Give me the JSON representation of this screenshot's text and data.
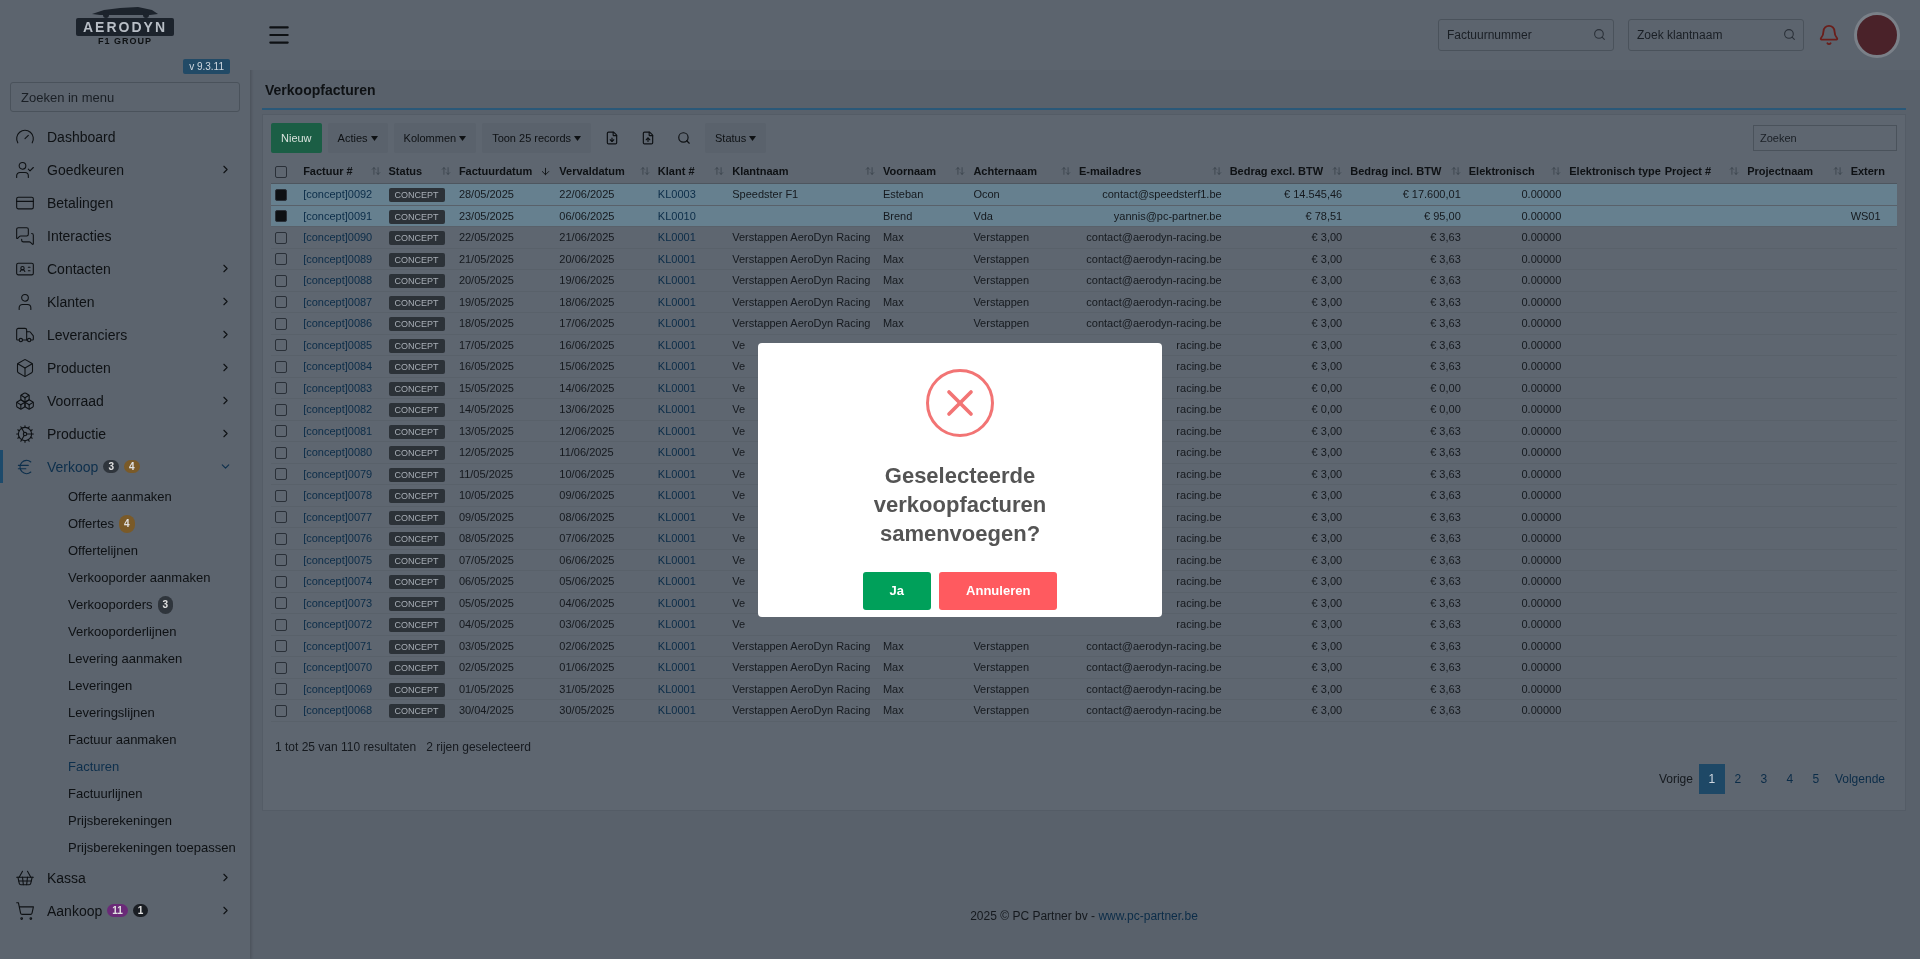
{
  "sidebar": {
    "logo": {
      "name": "AERODYN",
      "sub": "F1 GROUP"
    },
    "version": "v 9.3.11",
    "search_placeholder": "Zoeken in menu",
    "items": [
      {
        "label": "Dashboard",
        "has_children": false,
        "selected": false
      },
      {
        "label": "Goedkeuren",
        "has_children": true,
        "selected": false
      },
      {
        "label": "Betalingen",
        "has_children": false,
        "selected": false
      },
      {
        "label": "Interacties",
        "has_children": false,
        "selected": false
      },
      {
        "label": "Contacten",
        "has_children": true,
        "selected": false
      },
      {
        "label": "Klanten",
        "has_children": true,
        "selected": false
      },
      {
        "label": "Leveranciers",
        "has_children": true,
        "selected": false
      },
      {
        "label": "Producten",
        "has_children": true,
        "selected": false
      },
      {
        "label": "Voorraad",
        "has_children": true,
        "selected": false
      },
      {
        "label": "Productie",
        "has_children": true,
        "selected": false
      },
      {
        "label": "Verkoop",
        "has_children": true,
        "selected": true,
        "expanded": true,
        "badges": [
          {
            "text": "3",
            "color": "#2f353c"
          },
          {
            "text": "4",
            "color": "#7a5a28"
          }
        ],
        "children": [
          {
            "label": "Offerte aanmaken",
            "selected": false
          },
          {
            "label": "Offertes",
            "selected": false,
            "badges": [
              {
                "text": "4",
                "color": "#7a5a28"
              }
            ]
          },
          {
            "label": "Offertelijnen",
            "selected": false
          },
          {
            "label": "Verkooporder aanmaken",
            "selected": false
          },
          {
            "label": "Verkooporders",
            "selected": false,
            "badges": [
              {
                "text": "3",
                "color": "#2f353c"
              }
            ]
          },
          {
            "label": "Verkooporderlijnen",
            "selected": false
          },
          {
            "label": "Levering aanmaken",
            "selected": false
          },
          {
            "label": "Leveringen",
            "selected": false
          },
          {
            "label": "Leveringslijnen",
            "selected": false
          },
          {
            "label": "Factuur aanmaken",
            "selected": false
          },
          {
            "label": "Facturen",
            "selected": true
          },
          {
            "label": "Factuurlijnen",
            "selected": false
          },
          {
            "label": "Prijsberekeningen",
            "selected": false
          },
          {
            "label": "Prijsberekeningen toepassen",
            "selected": false
          }
        ]
      },
      {
        "label": "Kassa",
        "has_children": true,
        "selected": false
      },
      {
        "label": "Aankoop",
        "has_children": true,
        "selected": false,
        "badges": [
          {
            "text": "11",
            "color": "#6a2a78"
          },
          {
            "text": "1",
            "color": "#1a1e24"
          }
        ]
      }
    ]
  },
  "header": {
    "search_fields": [
      {
        "placeholder": "Factuurnummer"
      },
      {
        "placeholder": "Zoek klantnaam"
      }
    ]
  },
  "page": {
    "title": "Verkoopfacturen"
  },
  "toolbar": {
    "buttons": [
      {
        "kind": "primary",
        "label": "Nieuw"
      },
      {
        "kind": "dropdown",
        "label": "Acties"
      },
      {
        "kind": "dropdown",
        "label": "Kolommen"
      },
      {
        "kind": "dropdown",
        "label": "Toon 25 records"
      },
      {
        "kind": "icon"
      },
      {
        "kind": "icon"
      },
      {
        "kind": "icon"
      },
      {
        "kind": "dropdown",
        "label": "Status"
      }
    ],
    "search_placeholder": "Zoeken"
  },
  "table": {
    "select_all_checked": false,
    "columns": [
      {
        "label": "Factuur #",
        "sortable": true,
        "sorted": false
      },
      {
        "label": "Status",
        "sortable": true,
        "sorted": false
      },
      {
        "label": "Factuurdatum",
        "sortable": true,
        "sorted": true
      },
      {
        "label": "Vervaldatum",
        "sortable": true,
        "sorted": false
      },
      {
        "label": "Klant #",
        "sortable": true,
        "sorted": false
      },
      {
        "label": "Klantnaam",
        "sortable": true,
        "sorted": false
      },
      {
        "label": "Voornaam",
        "sortable": true,
        "sorted": false
      },
      {
        "label": "Achternaam",
        "sortable": true,
        "sorted": false
      },
      {
        "label": "E-mailadres",
        "sortable": true,
        "sorted": false
      },
      {
        "label": "Bedrag excl. BTW",
        "sortable": true,
        "sorted": false
      },
      {
        "label": "Bedrag incl. BTW",
        "sortable": true,
        "sorted": false
      },
      {
        "label": "Elektronisch",
        "sortable": true,
        "sorted": false
      },
      {
        "label": "Elektronisch type",
        "sortable": false
      },
      {
        "label": "Project #",
        "sortable": true,
        "sorted": false
      },
      {
        "label": "Projectnaam",
        "sortable": true,
        "sorted": false
      },
      {
        "label": "Extern",
        "sortable": false
      }
    ],
    "rows": [
      {
        "selected": true,
        "factuur": "[concept]0092",
        "status": "CONCEPT",
        "datum": "28/05/2025",
        "verval": "22/06/2025",
        "klant": "KL0003",
        "klantnaam": "Speedster F1",
        "voornaam": "Esteban",
        "achternaam": "Ocon",
        "email": "contact@speedsterf1.be",
        "excl": "€ 14.545,46",
        "incl": "€ 17.600,01",
        "elek": "0.00000"
      },
      {
        "selected": true,
        "factuur": "[concept]0091",
        "status": "CONCEPT",
        "datum": "23/05/2025",
        "verval": "06/06/2025",
        "klant": "KL0010",
        "voornaam": "Brend",
        "achternaam": "Vda",
        "email": "yannis@pc-partner.be",
        "excl": "€ 78,51",
        "incl": "€ 95,00",
        "elek": "0.00000",
        "extern": "WS01"
      },
      {
        "selected": false,
        "factuur": "[concept]0090",
        "status": "CONCEPT",
        "datum": "22/05/2025",
        "verval": "21/06/2025",
        "klant": "KL0001",
        "klantnaam": "Verstappen AeroDyn Racing",
        "voornaam": "Max",
        "achternaam": "Verstappen",
        "email": "contact@aerodyn-racing.be",
        "excl": "€ 3,00",
        "incl": "€ 3,63",
        "elek": "0.00000"
      },
      {
        "selected": false,
        "factuur": "[concept]0089",
        "status": "CONCEPT",
        "datum": "21/05/2025",
        "verval": "20/06/2025",
        "klant": "KL0001",
        "klantnaam": "Verstappen AeroDyn Racing",
        "voornaam": "Max",
        "achternaam": "Verstappen",
        "email": "contact@aerodyn-racing.be",
        "excl": "€ 3,00",
        "incl": "€ 3,63",
        "elek": "0.00000"
      },
      {
        "selected": false,
        "factuur": "[concept]0088",
        "status": "CONCEPT",
        "datum": "20/05/2025",
        "verval": "19/06/2025",
        "klant": "KL0001",
        "klantnaam": "Verstappen AeroDyn Racing",
        "voornaam": "Max",
        "achternaam": "Verstappen",
        "email": "contact@aerodyn-racing.be",
        "excl": "€ 3,00",
        "incl": "€ 3,63",
        "elek": "0.00000"
      },
      {
        "selected": false,
        "factuur": "[concept]0087",
        "status": "CONCEPT",
        "datum": "19/05/2025",
        "verval": "18/06/2025",
        "klant": "KL0001",
        "klantnaam": "Verstappen AeroDyn Racing",
        "voornaam": "Max",
        "achternaam": "Verstappen",
        "email": "contact@aerodyn-racing.be",
        "excl": "€ 3,00",
        "incl": "€ 3,63",
        "elek": "0.00000"
      },
      {
        "selected": false,
        "factuur": "[concept]0086",
        "status": "CONCEPT",
        "datum": "18/05/2025",
        "verval": "17/06/2025",
        "klant": "KL0001",
        "klantnaam": "Verstappen AeroDyn Racing",
        "voornaam": "Max",
        "achternaam": "Verstappen",
        "email": "contact@aerodyn-racing.be",
        "excl": "€ 3,00",
        "incl": "€ 3,63",
        "elek": "0.00000"
      },
      {
        "selected": false,
        "factuur": "[concept]0085",
        "status": "CONCEPT",
        "datum": "17/05/2025",
        "verval": "16/06/2025",
        "klant": "KL0001",
        "klantnaam": "Ve",
        "email": "racing.be",
        "excl": "€ 3,00",
        "incl": "€ 3,63",
        "elek": "0.00000"
      },
      {
        "selected": false,
        "factuur": "[concept]0084",
        "status": "CONCEPT",
        "datum": "16/05/2025",
        "verval": "15/06/2025",
        "klant": "KL0001",
        "klantnaam": "Ve",
        "email": "racing.be",
        "excl": "€ 3,00",
        "incl": "€ 3,63",
        "elek": "0.00000"
      },
      {
        "selected": false,
        "factuur": "[concept]0083",
        "status": "CONCEPT",
        "datum": "15/05/2025",
        "verval": "14/06/2025",
        "klant": "KL0001",
        "klantnaam": "Ve",
        "email": "racing.be",
        "excl": "€ 0,00",
        "incl": "€ 0,00",
        "elek": "0.00000"
      },
      {
        "selected": false,
        "factuur": "[concept]0082",
        "status": "CONCEPT",
        "datum": "14/05/2025",
        "verval": "13/06/2025",
        "klant": "KL0001",
        "klantnaam": "Ve",
        "email": "racing.be",
        "excl": "€ 0,00",
        "incl": "€ 0,00",
        "elek": "0.00000"
      },
      {
        "selected": false,
        "factuur": "[concept]0081",
        "status": "CONCEPT",
        "datum": "13/05/2025",
        "verval": "12/06/2025",
        "klant": "KL0001",
        "klantnaam": "Ve",
        "email": "racing.be",
        "excl": "€ 3,00",
        "incl": "€ 3,63",
        "elek": "0.00000"
      },
      {
        "selected": false,
        "factuur": "[concept]0080",
        "status": "CONCEPT",
        "datum": "12/05/2025",
        "verval": "11/06/2025",
        "klant": "KL0001",
        "klantnaam": "Ve",
        "email": "racing.be",
        "excl": "€ 3,00",
        "incl": "€ 3,63",
        "elek": "0.00000"
      },
      {
        "selected": false,
        "factuur": "[concept]0079",
        "status": "CONCEPT",
        "datum": "11/05/2025",
        "verval": "10/06/2025",
        "klant": "KL0001",
        "klantnaam": "Ve",
        "email": "racing.be",
        "excl": "€ 3,00",
        "incl": "€ 3,63",
        "elek": "0.00000"
      },
      {
        "selected": false,
        "factuur": "[concept]0078",
        "status": "CONCEPT",
        "datum": "10/05/2025",
        "verval": "09/06/2025",
        "klant": "KL0001",
        "klantnaam": "Ve",
        "email": "racing.be",
        "excl": "€ 3,00",
        "incl": "€ 3,63",
        "elek": "0.00000"
      },
      {
        "selected": false,
        "factuur": "[concept]0077",
        "status": "CONCEPT",
        "datum": "09/05/2025",
        "verval": "08/06/2025",
        "klant": "KL0001",
        "klantnaam": "Ve",
        "email": "racing.be",
        "excl": "€ 3,00",
        "incl": "€ 3,63",
        "elek": "0.00000"
      },
      {
        "selected": false,
        "factuur": "[concept]0076",
        "status": "CONCEPT",
        "datum": "08/05/2025",
        "verval": "07/06/2025",
        "klant": "KL0001",
        "klantnaam": "Ve",
        "email": "racing.be",
        "excl": "€ 3,00",
        "incl": "€ 3,63",
        "elek": "0.00000"
      },
      {
        "selected": false,
        "factuur": "[concept]0075",
        "status": "CONCEPT",
        "datum": "07/05/2025",
        "verval": "06/06/2025",
        "klant": "KL0001",
        "klantnaam": "Ve",
        "email": "racing.be",
        "excl": "€ 3,00",
        "incl": "€ 3,63",
        "elek": "0.00000"
      },
      {
        "selected": false,
        "factuur": "[concept]0074",
        "status": "CONCEPT",
        "datum": "06/05/2025",
        "verval": "05/06/2025",
        "klant": "KL0001",
        "klantnaam": "Ve",
        "email": "racing.be",
        "excl": "€ 3,00",
        "incl": "€ 3,63",
        "elek": "0.00000"
      },
      {
        "selected": false,
        "factuur": "[concept]0073",
        "status": "CONCEPT",
        "datum": "05/05/2025",
        "verval": "04/06/2025",
        "klant": "KL0001",
        "klantnaam": "Ve",
        "email": "racing.be",
        "excl": "€ 3,00",
        "incl": "€ 3,63",
        "elek": "0.00000"
      },
      {
        "selected": false,
        "factuur": "[concept]0072",
        "status": "CONCEPT",
        "datum": "04/05/2025",
        "verval": "03/06/2025",
        "klant": "KL0001",
        "klantnaam": "Ve",
        "email": "racing.be",
        "excl": "€ 3,00",
        "incl": "€ 3,63",
        "elek": "0.00000"
      },
      {
        "selected": false,
        "factuur": "[concept]0071",
        "status": "CONCEPT",
        "datum": "03/05/2025",
        "verval": "02/06/2025",
        "klant": "KL0001",
        "klantnaam": "Verstappen AeroDyn Racing",
        "voornaam": "Max",
        "achternaam": "Verstappen",
        "email": "contact@aerodyn-racing.be",
        "excl": "€ 3,00",
        "incl": "€ 3,63",
        "elek": "0.00000"
      },
      {
        "selected": false,
        "factuur": "[concept]0070",
        "status": "CONCEPT",
        "datum": "02/05/2025",
        "verval": "01/06/2025",
        "klant": "KL0001",
        "klantnaam": "Verstappen AeroDyn Racing",
        "voornaam": "Max",
        "achternaam": "Verstappen",
        "email": "contact@aerodyn-racing.be",
        "excl": "€ 3,00",
        "incl": "€ 3,63",
        "elek": "0.00000"
      },
      {
        "selected": false,
        "factuur": "[concept]0069",
        "status": "CONCEPT",
        "datum": "01/05/2025",
        "verval": "31/05/2025",
        "klant": "KL0001",
        "klantnaam": "Verstappen AeroDyn Racing",
        "voornaam": "Max",
        "achternaam": "Verstappen",
        "email": "contact@aerodyn-racing.be",
        "excl": "€ 3,00",
        "incl": "€ 3,63",
        "elek": "0.00000"
      },
      {
        "selected": false,
        "factuur": "[concept]0068",
        "status": "CONCEPT",
        "datum": "30/04/2025",
        "verval": "30/05/2025",
        "klant": "KL0001",
        "klantnaam": "Verstappen AeroDyn Racing",
        "voornaam": "Max",
        "achternaam": "Verstappen",
        "email": "contact@aerodyn-racing.be",
        "excl": "€ 3,00",
        "incl": "€ 3,63",
        "elek": "0.00000"
      }
    ]
  },
  "summary": {
    "results": "1 tot 25 van 110 resultaten",
    "selection": "2 rijen geselecteerd"
  },
  "pagination": {
    "previous": "Vorige",
    "next": "Volgende",
    "pages": [
      {
        "label": "1",
        "selected": true
      },
      {
        "label": "2",
        "selected": false
      },
      {
        "label": "3",
        "selected": false
      },
      {
        "label": "4",
        "selected": false
      },
      {
        "label": "5",
        "selected": false
      }
    ]
  },
  "footer": {
    "text": "2025 © PC Partner bv - ",
    "link": "www.pc-partner.be"
  },
  "modal": {
    "title": "Geselecteerde verkoopfacturen samenvoegen?",
    "buttons": [
      {
        "kind": "confirm",
        "label": "Ja"
      },
      {
        "kind": "cancel",
        "label": "Annuleren"
      }
    ]
  }
}
